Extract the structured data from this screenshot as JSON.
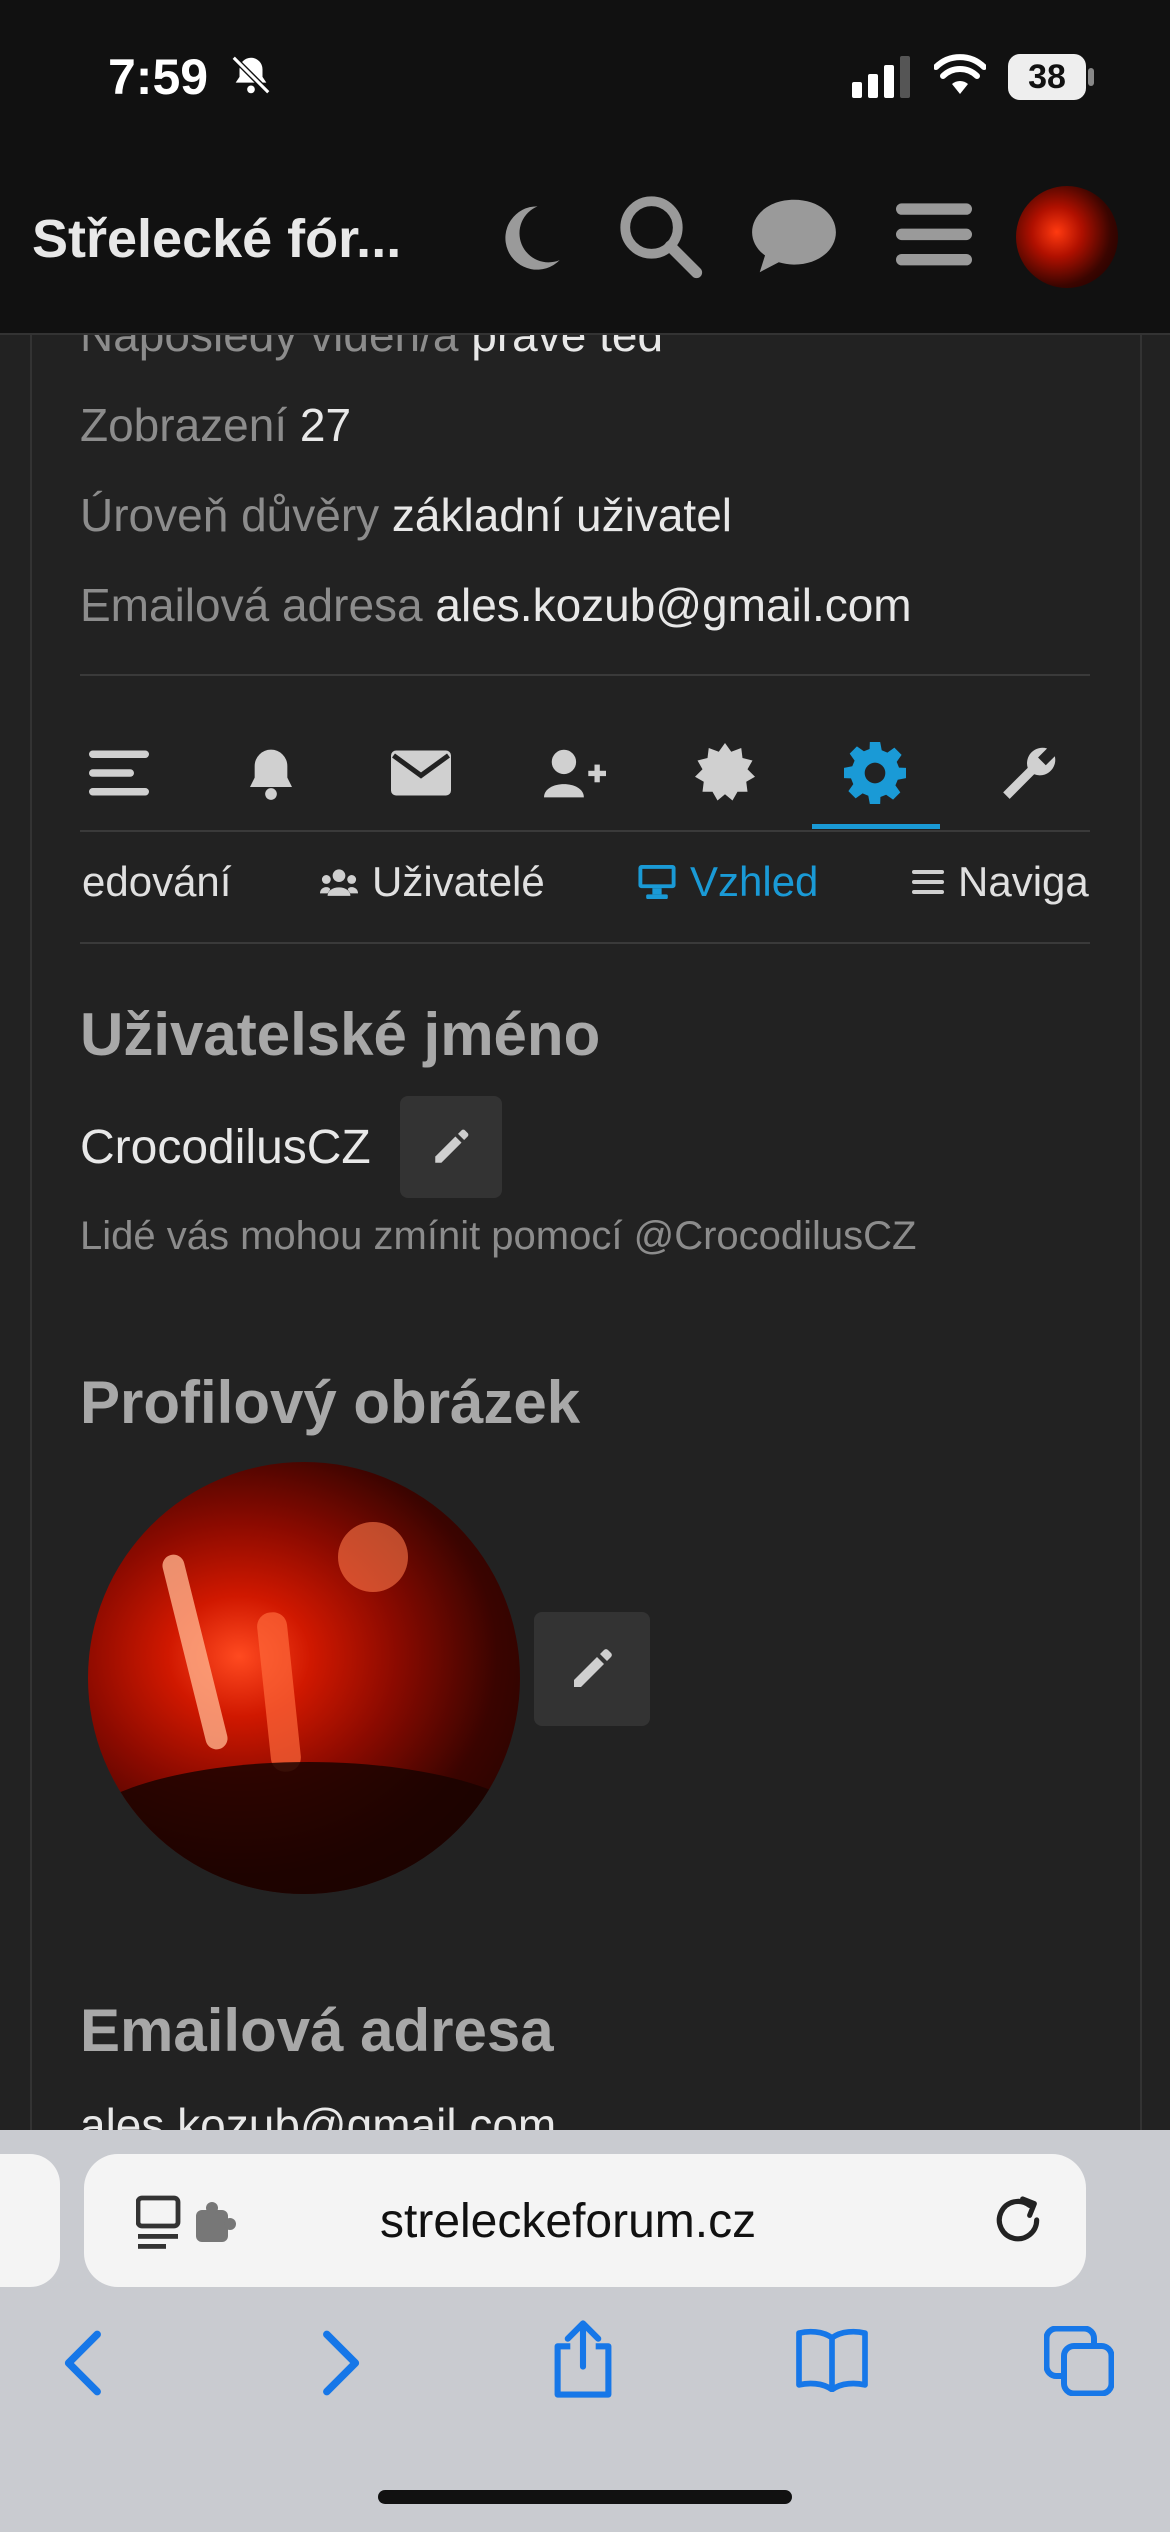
{
  "status_bar": {
    "time": "7:59",
    "battery": "38"
  },
  "header": {
    "site_title": "Střelecké fór...",
    "icons": [
      "moon-icon",
      "search-icon",
      "chat-icon",
      "menu-icon",
      "avatar"
    ]
  },
  "profile_meta": {
    "last_seen_label": "Naposledy viděn/a",
    "last_seen_value": "právě teď",
    "views_label": "Zobrazení",
    "views_value": "27",
    "trust_label": "Úroveň důvěry",
    "trust_value": "základní uživatel",
    "email_label": "Emailová adresa",
    "email_value": "ales.kozub@gmail.com"
  },
  "nav_icons": [
    "list-icon",
    "bell-icon",
    "envelope-icon",
    "user-plus-icon",
    "badge-icon",
    "gear-icon",
    "wrench-icon"
  ],
  "subnav": {
    "items": [
      {
        "label": "edování",
        "icon": ""
      },
      {
        "label": "Uživatelé",
        "icon": "users-icon"
      },
      {
        "label": "Vzhled",
        "icon": "monitor-icon",
        "active": true
      },
      {
        "label": "Naviga",
        "icon": "list-icon"
      }
    ]
  },
  "username_section": {
    "heading": "Uživatelské jméno",
    "username": "CrocodilusCZ",
    "hint": "Lidé vás mohou zmínit pomocí @CrocodilusCZ"
  },
  "avatar_section": {
    "heading": "Profilový obrázek"
  },
  "email_section": {
    "heading": "Emailová adresa",
    "value_partial": "ales.kozub@gmail.com"
  },
  "browser": {
    "url": "streleckeforum.cz"
  },
  "colors": {
    "accent": "#1a9ad6",
    "background": "#222222",
    "header": "#111111"
  }
}
